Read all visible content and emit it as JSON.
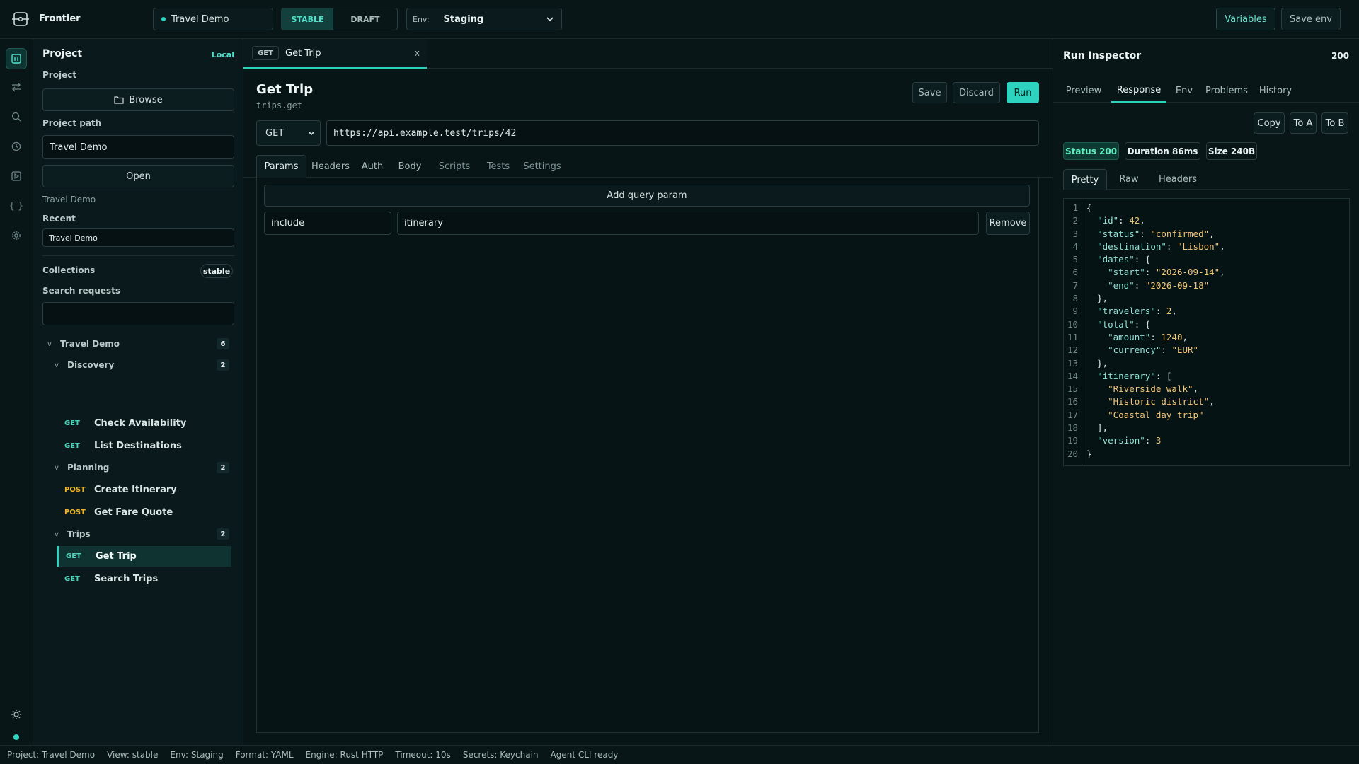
{
  "app": {
    "name": "Frontier"
  },
  "top": {
    "project_select": "Travel Demo",
    "stable_label": "STABLE",
    "draft_label": "DRAFT",
    "env_label": "Env:",
    "env_value": "Staging",
    "variables_label": "Variables",
    "save_env_label": "Save env"
  },
  "sidebar": {
    "title": "Project",
    "local_label": "Local",
    "project_label": "Project",
    "browse_label": "Browse",
    "project_path_label": "Project path",
    "project_path_value": "Travel Demo",
    "open_label": "Open",
    "project_name": "Travel Demo",
    "recent_label": "Recent",
    "recent_item": "Travel Demo",
    "collections_label": "Collections",
    "collections_badge": "stable",
    "search_label": "Search requests",
    "search_placeholder": "",
    "tree": {
      "root": {
        "label": "Travel Demo",
        "count": "6"
      },
      "folders": [
        {
          "label": "Discovery",
          "count": "2",
          "items": [
            {
              "method": "GET",
              "label": "Check Availability"
            },
            {
              "method": "GET",
              "label": "List Destinations"
            }
          ]
        },
        {
          "label": "Planning",
          "count": "2",
          "items": [
            {
              "method": "POST",
              "label": "Create Itinerary"
            },
            {
              "method": "POST",
              "label": "Get Fare Quote"
            }
          ]
        },
        {
          "label": "Trips",
          "count": "2",
          "items": [
            {
              "method": "GET",
              "label": "Get Trip"
            },
            {
              "method": "GET",
              "label": "Search Trips"
            }
          ]
        }
      ]
    }
  },
  "editor": {
    "tab": {
      "method": "GET",
      "label": "Get Trip",
      "close": "x"
    },
    "title": "Get Trip",
    "subtitle": "trips.get",
    "save_label": "Save",
    "discard_label": "Discard",
    "run_label": "Run",
    "method": "GET",
    "url": "https://api.example.test/trips/42",
    "tabs": [
      "Params",
      "Headers",
      "Auth",
      "Body",
      "Scripts",
      "Tests",
      "Settings"
    ],
    "add_param_label": "Add query param",
    "param_key": "include",
    "param_value": "itinerary",
    "remove_label": "Remove"
  },
  "inspector": {
    "title": "Run Inspector",
    "status_code": "200",
    "tabs": [
      "Preview",
      "Response",
      "Env",
      "Problems",
      "History"
    ],
    "copy_label": "Copy",
    "to_a_label": "To A",
    "to_b_label": "To B",
    "status_badge": "Status 200",
    "duration_badge": "Duration 86ms",
    "size_badge": "Size 240B",
    "view_tabs": [
      "Pretty",
      "Raw",
      "Headers"
    ],
    "code_lines": [
      "{",
      "  \"id\": 42,",
      "  \"status\": \"confirmed\",",
      "  \"destination\": \"Lisbon\",",
      "  \"dates\": {",
      "    \"start\": \"2026-09-14\",",
      "    \"end\": \"2026-09-18\"",
      "  },",
      "  \"travelers\": 2,",
      "  \"total\": {",
      "    \"amount\": 1240,",
      "    \"currency\": \"EUR\"",
      "  },",
      "  \"itinerary\": [",
      "    \"Riverside walk\",",
      "    \"Historic district\",",
      "    \"Coastal day trip\"",
      "  ],",
      "  \"version\": 3",
      "}"
    ]
  },
  "statusbar": {
    "project": "Project: Travel Demo",
    "view": "View: stable",
    "env": "Env: Staging",
    "format": "Format: YAML",
    "engine": "Engine: Rust HTTP",
    "timeout": "Timeout: 10s",
    "secrets": "Secrets: Keychain",
    "agent": "Agent CLI ready"
  },
  "colors": {
    "accent": "#2ed3bf",
    "post": "#f0b429",
    "bg": "#071517"
  }
}
